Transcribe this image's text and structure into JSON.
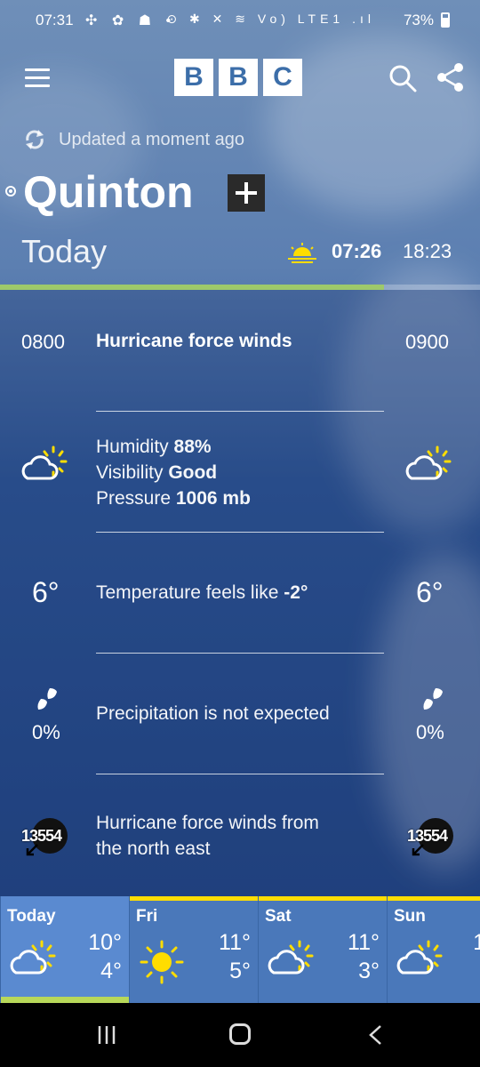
{
  "status_bar": {
    "time": "07:31",
    "left_icons": "✣ ✿ ☗ •",
    "right_icons": "⊙ ✱ ✕ ≋ Vo) LTE1 .ıl",
    "battery": "73%"
  },
  "header": {
    "logo_letters": [
      "B",
      "B",
      "C"
    ],
    "updated": "Updated a moment ago",
    "location": "Quinton",
    "day_label": "Today",
    "sunrise": "07:26",
    "sunset": "18:23",
    "progress_fraction": 0.8
  },
  "detail": {
    "time_left": "0800",
    "time_right": "0900",
    "title": "Hurricane force winds",
    "humidity_label": "Humidity",
    "humidity_value": "88%",
    "visibility_label": "Visibility",
    "visibility_value": "Good",
    "pressure_label": "Pressure",
    "pressure_value": "1006 mb",
    "temp_left": "6°",
    "temp_right": "6°",
    "feels_label": "Temperature feels like",
    "feels_value": "-2°",
    "precip_text": "Precipitation is not expected",
    "precip_left": "0%",
    "precip_right": "0%",
    "wind_text_line1": "Hurricane force winds from",
    "wind_text_line2": "the north east",
    "wind_left": "13554",
    "wind_right": "13554",
    "icon": "sun-behind-cloud-icon"
  },
  "forecast": [
    {
      "day": "Today",
      "high": "10°",
      "low": "4°",
      "icon": "sun-behind-cloud-icon"
    },
    {
      "day": "Fri",
      "high": "11°",
      "low": "5°",
      "icon": "sun-icon"
    },
    {
      "day": "Sat",
      "high": "11°",
      "low": "3°",
      "icon": "sun-behind-cloud-icon"
    },
    {
      "day": "Sun",
      "high": "1",
      "low": "",
      "icon": "sun-behind-cloud-icon"
    }
  ],
  "colors": {
    "accent_green": "#9ec96b",
    "sun_yellow": "#ffdd00",
    "sky_blue": "#2a4f8d"
  }
}
